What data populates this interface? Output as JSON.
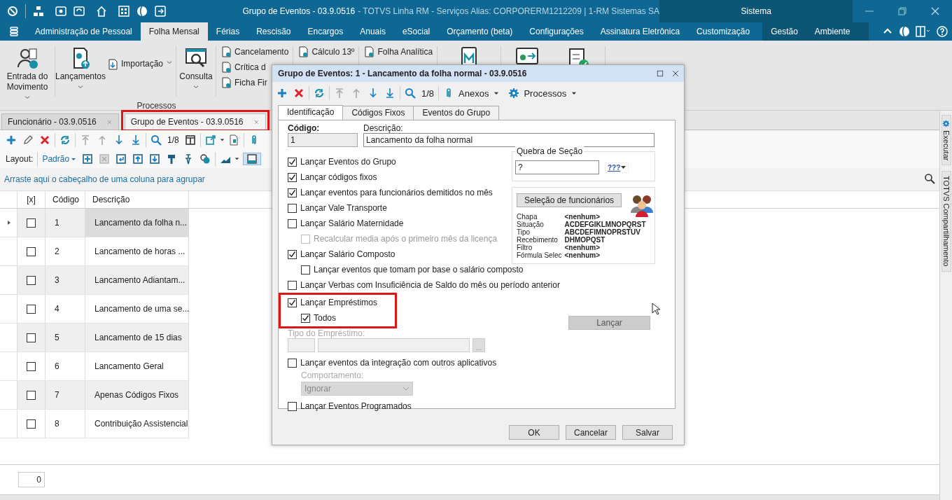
{
  "window": {
    "title": "Grupo de Eventos - 03.9.0516",
    "subtitle": "- TOTVS Linha RM - Serviços  Alias: CORPORERM1212209 | 1-RM Sistemas SA",
    "context_tab": "Sistema"
  },
  "menu": [
    {
      "label": "Administração de Pessoal",
      "selected": false
    },
    {
      "label": "Folha Mensal",
      "selected": true
    },
    {
      "label": "Férias",
      "selected": false
    },
    {
      "label": "Rescisão",
      "selected": false
    },
    {
      "label": "Encargos",
      "selected": false
    },
    {
      "label": "Anuais",
      "selected": false
    },
    {
      "label": "eSocial",
      "selected": false
    },
    {
      "label": "Orçamento (beta)",
      "selected": false
    },
    {
      "label": "Configurações",
      "selected": false
    },
    {
      "label": "Assinatura Eletrônica",
      "selected": false
    },
    {
      "label": "Customização",
      "selected": false
    }
  ],
  "context_menu": [
    {
      "label": "Gestão",
      "selected": false
    },
    {
      "label": "Ambiente",
      "selected": false
    }
  ],
  "ribbon": {
    "group_label": "Processos",
    "items": [
      {
        "kind": "large",
        "label": "Entrada do Movimento",
        "dropdown": true
      },
      {
        "kind": "large",
        "label": "Lançamentos",
        "dropdown": true
      },
      {
        "kind": "small",
        "label": "Importação",
        "dropdown": true
      },
      {
        "kind": "large",
        "label": "Consulta",
        "dropdown": true
      },
      {
        "kind": "column",
        "labels": [
          "Cancelamento",
          "Crítica d",
          "Ficha Fir"
        ]
      },
      {
        "kind": "column",
        "labels": [
          "Cálculo 13º"
        ]
      },
      {
        "kind": "column",
        "labels": [
          "Folha Analítica"
        ]
      }
    ]
  },
  "doc_tabs": [
    {
      "label": "Funcionário - 03.9.0516",
      "selected": false,
      "highlighted": false
    },
    {
      "label": "Grupo de Eventos - 03.9.0516",
      "selected": true,
      "highlighted": true
    }
  ],
  "toolbar": {
    "counter": "1/8"
  },
  "layout_bar": {
    "label": "Layout:",
    "value": "Padrão"
  },
  "group_hint": "Arraste aqui o cabeçalho de uma coluna para agrupar",
  "table": {
    "columns": [
      "[x]",
      "Código",
      "Descrição"
    ],
    "rows": [
      {
        "code": "1",
        "description": "Lancamento da folha n...",
        "checked": false,
        "selected": true
      },
      {
        "code": "2",
        "description": "Lancamento de horas ...",
        "checked": false,
        "selected": false
      },
      {
        "code": "3",
        "description": "Lancamento Adiantam...",
        "checked": false,
        "selected": false
      },
      {
        "code": "4",
        "description": "Lancamento de uma se...",
        "checked": false,
        "selected": false
      },
      {
        "code": "5",
        "description": "Lancamento de 15 dias",
        "checked": false,
        "selected": false
      },
      {
        "code": "6",
        "description": "Lancamento Geral",
        "checked": false,
        "selected": false
      },
      {
        "code": "7",
        "description": "Apenas Códigos Fixos",
        "checked": false,
        "selected": false
      },
      {
        "code": "8",
        "description": "Contribuição Assistencial",
        "checked": false,
        "selected": false
      }
    ]
  },
  "pager": {
    "value": "0"
  },
  "side_tabs": [
    "Executar",
    "TOTVS Compartilhamento"
  ],
  "dialog": {
    "title": "Grupo de Eventos: 1 - Lancamento da folha normal - 03.9.0516",
    "counter": "1/8",
    "attachments": "Anexos",
    "processes": "Processos",
    "tabs": [
      {
        "label": "Identificação",
        "selected": true
      },
      {
        "label": "Códigos Fixos",
        "selected": false
      },
      {
        "label": "Eventos do Grupo",
        "selected": false
      }
    ],
    "code": {
      "label": "Código:",
      "value": "1"
    },
    "description": {
      "label": "Descrição:",
      "value": "Lancamento da folha normal"
    },
    "form": [
      {
        "kind": "checkbox",
        "label": "Lançar Eventos do Grupo",
        "checked": true,
        "disabled": false,
        "highlighted": false
      },
      {
        "kind": "checkbox",
        "label": "Lançar códigos fixos",
        "checked": true,
        "disabled": false,
        "highlighted": false
      },
      {
        "kind": "checkbox",
        "label": "Lançar eventos para funcionários demitidos no mês",
        "checked": true,
        "disabled": false,
        "highlighted": false
      },
      {
        "kind": "checkbox",
        "label": "Lançar Vale Transporte",
        "checked": false,
        "disabled": false,
        "highlighted": false
      },
      {
        "kind": "checkbox",
        "label": "Lançar Salário Maternidade",
        "checked": false,
        "disabled": false,
        "highlighted": false,
        "children": [
          {
            "label": "Recalcular media após o primeiro mês da licença",
            "checked": false,
            "disabled": true
          }
        ]
      },
      {
        "kind": "checkbox",
        "label": "Lançar Salário Composto",
        "checked": true,
        "disabled": false,
        "highlighted": false,
        "children": [
          {
            "label": "Lançar eventos que tomam por base o salário composto",
            "checked": false,
            "disabled": false
          }
        ]
      },
      {
        "kind": "checkbox",
        "label": "Lançar Verbas com Insuficiência de Saldo do mês ou período anterior",
        "checked": false,
        "disabled": false,
        "highlighted": false
      },
      {
        "kind": "checkbox",
        "label": "Lançar Empréstimos",
        "checked": true,
        "disabled": false,
        "highlighted": true,
        "children": [
          {
            "label": "Todos",
            "checked": true,
            "disabled": false
          }
        ]
      },
      {
        "kind": "lookup",
        "label": "Tipo do Empréstimo:",
        "button": "...",
        "disabled": true
      },
      {
        "kind": "checkbox",
        "label": "Lançar eventos da integração com outros aplicativos",
        "checked": false,
        "disabled": false,
        "highlighted": false
      },
      {
        "kind": "select",
        "label": "Comportamento:",
        "value": "Ignorar",
        "disabled": true
      },
      {
        "kind": "checkbox",
        "label": "Lançar Eventos Programados",
        "checked": false,
        "disabled": false,
        "highlighted": false
      }
    ],
    "section_break": {
      "label": "Quebra de Seção",
      "value": "?",
      "button": "???"
    },
    "selection": {
      "button": "Seleção de funcionários",
      "fields": [
        {
          "label": "Chapa",
          "value": "<nenhum>"
        },
        {
          "label": "Situação",
          "value": "ACDEFGIKLMNOPQRST"
        },
        {
          "label": "Tipo",
          "value": "ABCDEFIMNOPRSTUV"
        },
        {
          "label": "Recebimento",
          "value": "DHMOPQST"
        },
        {
          "label": "Filtro",
          "value": "<nenhum>"
        },
        {
          "label": "Fórmula Selec",
          "value": "<nenhum>"
        }
      ]
    },
    "launch_button": {
      "label": "Lançar",
      "disabled": true
    },
    "buttons": [
      "OK",
      "Cancelar",
      "Salvar"
    ]
  }
}
